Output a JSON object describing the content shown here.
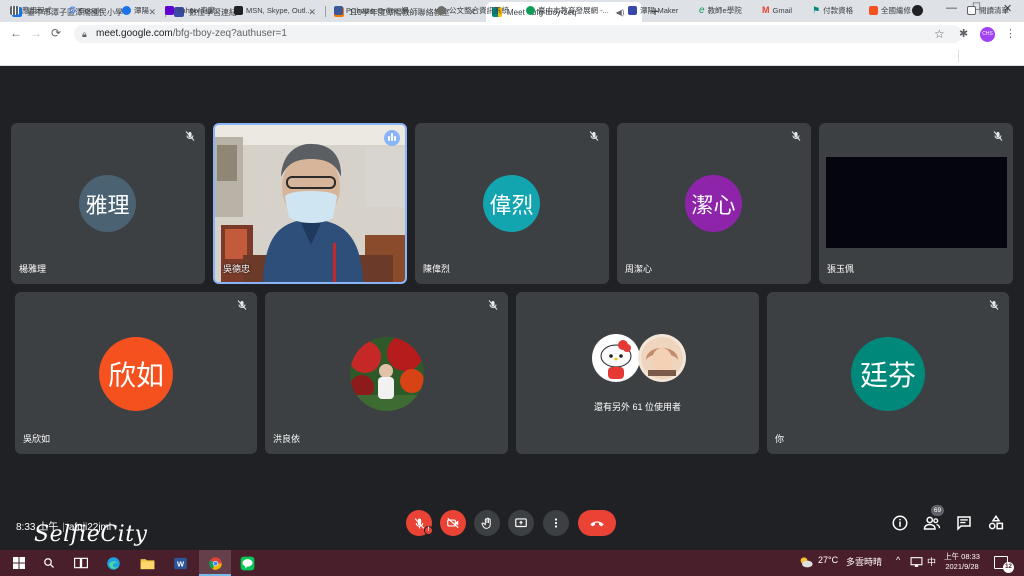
{
  "browser": {
    "tabs": [
      {
        "title": "臺中市潭子區潭陽國民小學",
        "active": false,
        "favicon_color": "#1a73e8"
      },
      {
        "title": "數位學習連結",
        "active": false,
        "favicon_color": "#3949ab"
      },
      {
        "title": "110學年度潭陽教師聯絡教室",
        "active": false,
        "favicon_color": "#f57c00"
      },
      {
        "title": "Meet - bfg-tboy-zeq",
        "active": true,
        "favicon_color": "#00897b"
      }
    ],
    "url_host": "meet.google.com",
    "url_path": "/bfg-tboy-zeq?authuser=1",
    "profile_initials": "CHS",
    "bookmarks": [
      {
        "label": "應用程式",
        "color": "#5f6368"
      },
      {
        "label": "Google",
        "color": "#4285f4"
      },
      {
        "label": "潭陽",
        "color": "#1a73e8"
      },
      {
        "label": "Yahoo!奇摩",
        "color": "#6001d2"
      },
      {
        "label": "MSN, Skype, Outl...",
        "color": "#202124"
      },
      {
        "label": "PChome Online 網...",
        "color": "#3b5998"
      },
      {
        "label": "公文整合資訊系統",
        "color": "#6d6d6d"
      },
      {
        "label": "臺中市教育發展網 -...",
        "color": "#0f9d58"
      },
      {
        "label": "潭陽-Maker",
        "color": "#3949ab"
      },
      {
        "label": "教師e學院",
        "color": "#0f9d58"
      },
      {
        "label": "Gmail",
        "color": "#ea4335"
      },
      {
        "label": "付款資格",
        "color": "#00897b"
      },
      {
        "label": "全國繼修",
        "color": "#f4511e"
      }
    ],
    "reading_list": "閱讀清單"
  },
  "meet": {
    "tiles": [
      {
        "name": "楊雅理",
        "avatar_text": "雅理",
        "avatar_color": "#4a6272",
        "muted": true
      },
      {
        "name": "吳德忠",
        "video": true,
        "speaking": true
      },
      {
        "name": "陳偉烈",
        "avatar_text": "偉烈",
        "avatar_color": "#12a4af",
        "muted": true
      },
      {
        "name": "周潔心",
        "avatar_text": "潔心",
        "avatar_color": "#8e24aa",
        "muted": true
      },
      {
        "name": "張玉佩",
        "black_video": true,
        "muted": true
      },
      {
        "name": "吳欣如",
        "avatar_text": "欣如",
        "avatar_color": "#f4511e",
        "muted": true
      },
      {
        "name": "洪良依",
        "photo_avatar": true,
        "muted": true
      },
      {
        "others_text": "還有另外 61 位使用者"
      },
      {
        "name": "你",
        "avatar_text": "廷芬",
        "avatar_color": "#00897b",
        "muted": true
      }
    ],
    "time": "8:33 上午",
    "meeting_code": "afqji22jml",
    "participants_count": "69",
    "watermark": "SelfieCity"
  },
  "taskbar": {
    "temperature": "27°C",
    "weather": "多雲時晴",
    "ime": "中",
    "clock_time": "上午 08:33",
    "clock_date": "2021/9/28",
    "notifications": "12"
  },
  "colors": {
    "accent": "#8ab4f8",
    "danger": "#ea4335",
    "tile": "#3c4043",
    "stage": "#202124"
  }
}
